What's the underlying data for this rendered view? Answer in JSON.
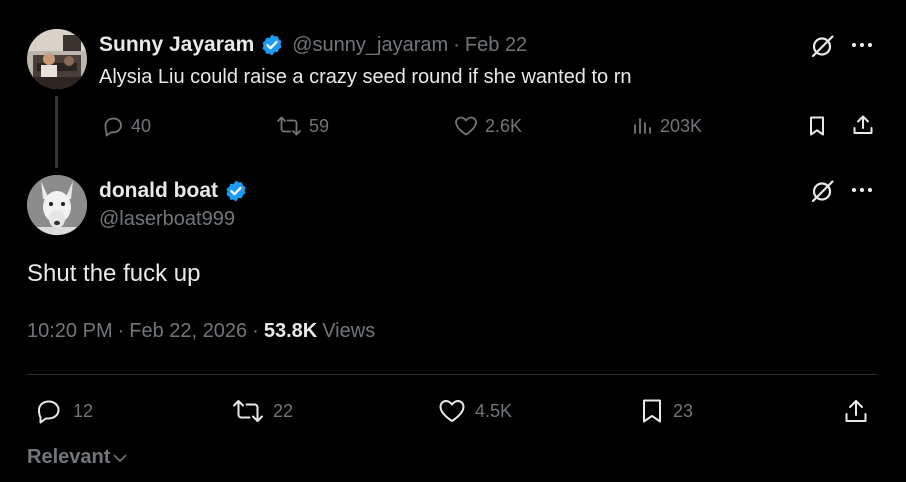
{
  "parent_tweet": {
    "author_name": "Sunny Jayaram",
    "handle": "@sunny_jayaram",
    "separator": "·",
    "date": "Feb 22",
    "text": "Alysia Liu could raise a crazy seed round if she wanted to rn",
    "replies": "40",
    "reposts": "59",
    "likes": "2.6K",
    "views": "203K"
  },
  "main_tweet": {
    "author_name": "donald boat",
    "handle": "@laserboat999",
    "text": "Shut the fuck up",
    "time": "10:20 PM",
    "separator1": "·",
    "date": "Feb 22, 2026",
    "separator2": "·",
    "views_count": "53.8K",
    "views_label": "Views",
    "replies": "12",
    "reposts": "22",
    "likes": "4.5K",
    "bookmarks": "23"
  },
  "sort": {
    "label": "Relevant"
  },
  "colors": {
    "verified_blue": "#1d9bf0",
    "text": "#e7e9ea",
    "muted": "#71767b",
    "background": "#000000",
    "divider": "#2f3336"
  },
  "icons": [
    "grok-icon",
    "more-icon",
    "reply-icon",
    "repost-icon",
    "like-icon",
    "views-icon",
    "bookmark-icon",
    "share-icon",
    "verified-badge-icon",
    "chevron-down-icon"
  ]
}
